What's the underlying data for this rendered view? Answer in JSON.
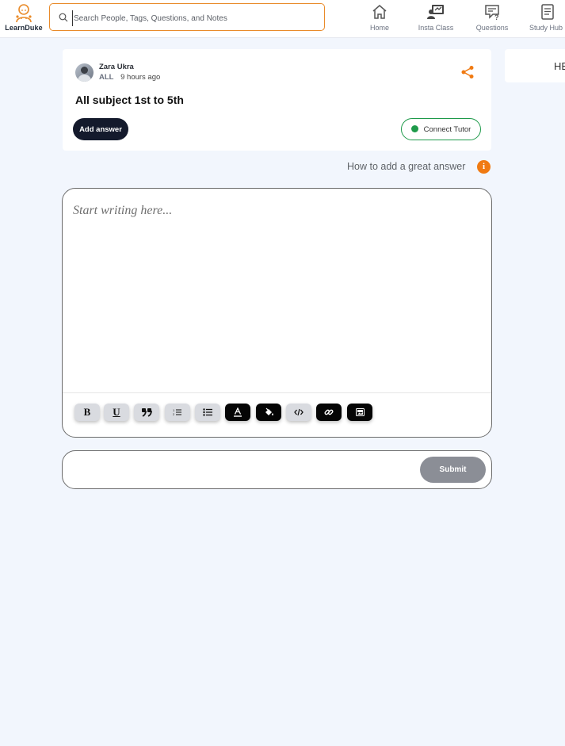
{
  "brand": {
    "name": "LearnDuke",
    "accent": "#e98b2a"
  },
  "search": {
    "placeholder": "Search People, Tags, Questions, and Notes",
    "value": ""
  },
  "nav": [
    {
      "label": "Home",
      "icon": "home-icon"
    },
    {
      "label": "Insta Class",
      "icon": "insta-class-icon"
    },
    {
      "label": "Questions",
      "icon": "questions-icon"
    },
    {
      "label": "Study Hub",
      "icon": "study-hub-icon"
    }
  ],
  "question": {
    "author": "Zara Ukra",
    "tag": "ALL",
    "time": "9 hours ago",
    "title": "All subject 1st to 5th",
    "add_answer_label": "Add answer",
    "connect_label": "Connect Tutor"
  },
  "side_panel": {
    "text": "HE"
  },
  "help": {
    "text": "How to add a great answer",
    "icon": "info-icon"
  },
  "editor": {
    "placeholder": "Start writing here...",
    "toolbar": [
      {
        "name": "bold-button",
        "icon": "bold-icon",
        "glyph": "B"
      },
      {
        "name": "underline-button",
        "icon": "underline-icon",
        "glyph": "U"
      },
      {
        "name": "quote-button",
        "icon": "quote-icon",
        "glyph": "❞"
      },
      {
        "name": "ordered-list-button",
        "icon": "ordered-list-icon"
      },
      {
        "name": "bullet-list-button",
        "icon": "bullet-list-icon"
      },
      {
        "name": "text-color-button",
        "icon": "text-color-icon"
      },
      {
        "name": "highlight-button",
        "icon": "paint-bucket-icon"
      },
      {
        "name": "code-button",
        "icon": "code-icon"
      },
      {
        "name": "link-button",
        "icon": "link-icon"
      },
      {
        "name": "image-button",
        "icon": "image-icon"
      }
    ]
  },
  "submit": {
    "label": "Submit"
  }
}
